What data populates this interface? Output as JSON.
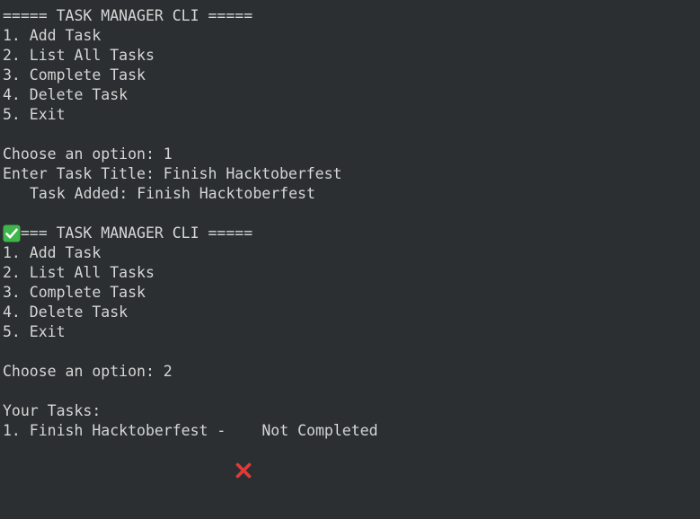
{
  "terminal": {
    "lines": [
      "===== TASK MANAGER CLI =====",
      "1. Add Task",
      "2. List All Tasks",
      "3. Complete Task",
      "4. Delete Task",
      "5. Exit",
      "",
      "Choose an option: 1",
      "Enter Task Title: Finish Hacktoberfest",
      "Task Added: Finish Hacktoberfest",
      "",
      "===== TASK MANAGER CLI =====",
      "1. Add Task",
      "2. List All Tasks",
      "3. Complete Task",
      "4. Delete Task",
      "5. Exit",
      "",
      "Choose an option: 2",
      "",
      "Your Tasks:",
      "1. Finish Hacktoberfest -",
      "Not Completed"
    ],
    "icons": {
      "task_added": "check-mark-icon",
      "not_completed": "cross-mark-icon"
    },
    "colors": {
      "background": "#2b2f31",
      "text": "#d6d6d6",
      "check_green": "#3fb54b",
      "cross_red": "#e53935"
    }
  }
}
